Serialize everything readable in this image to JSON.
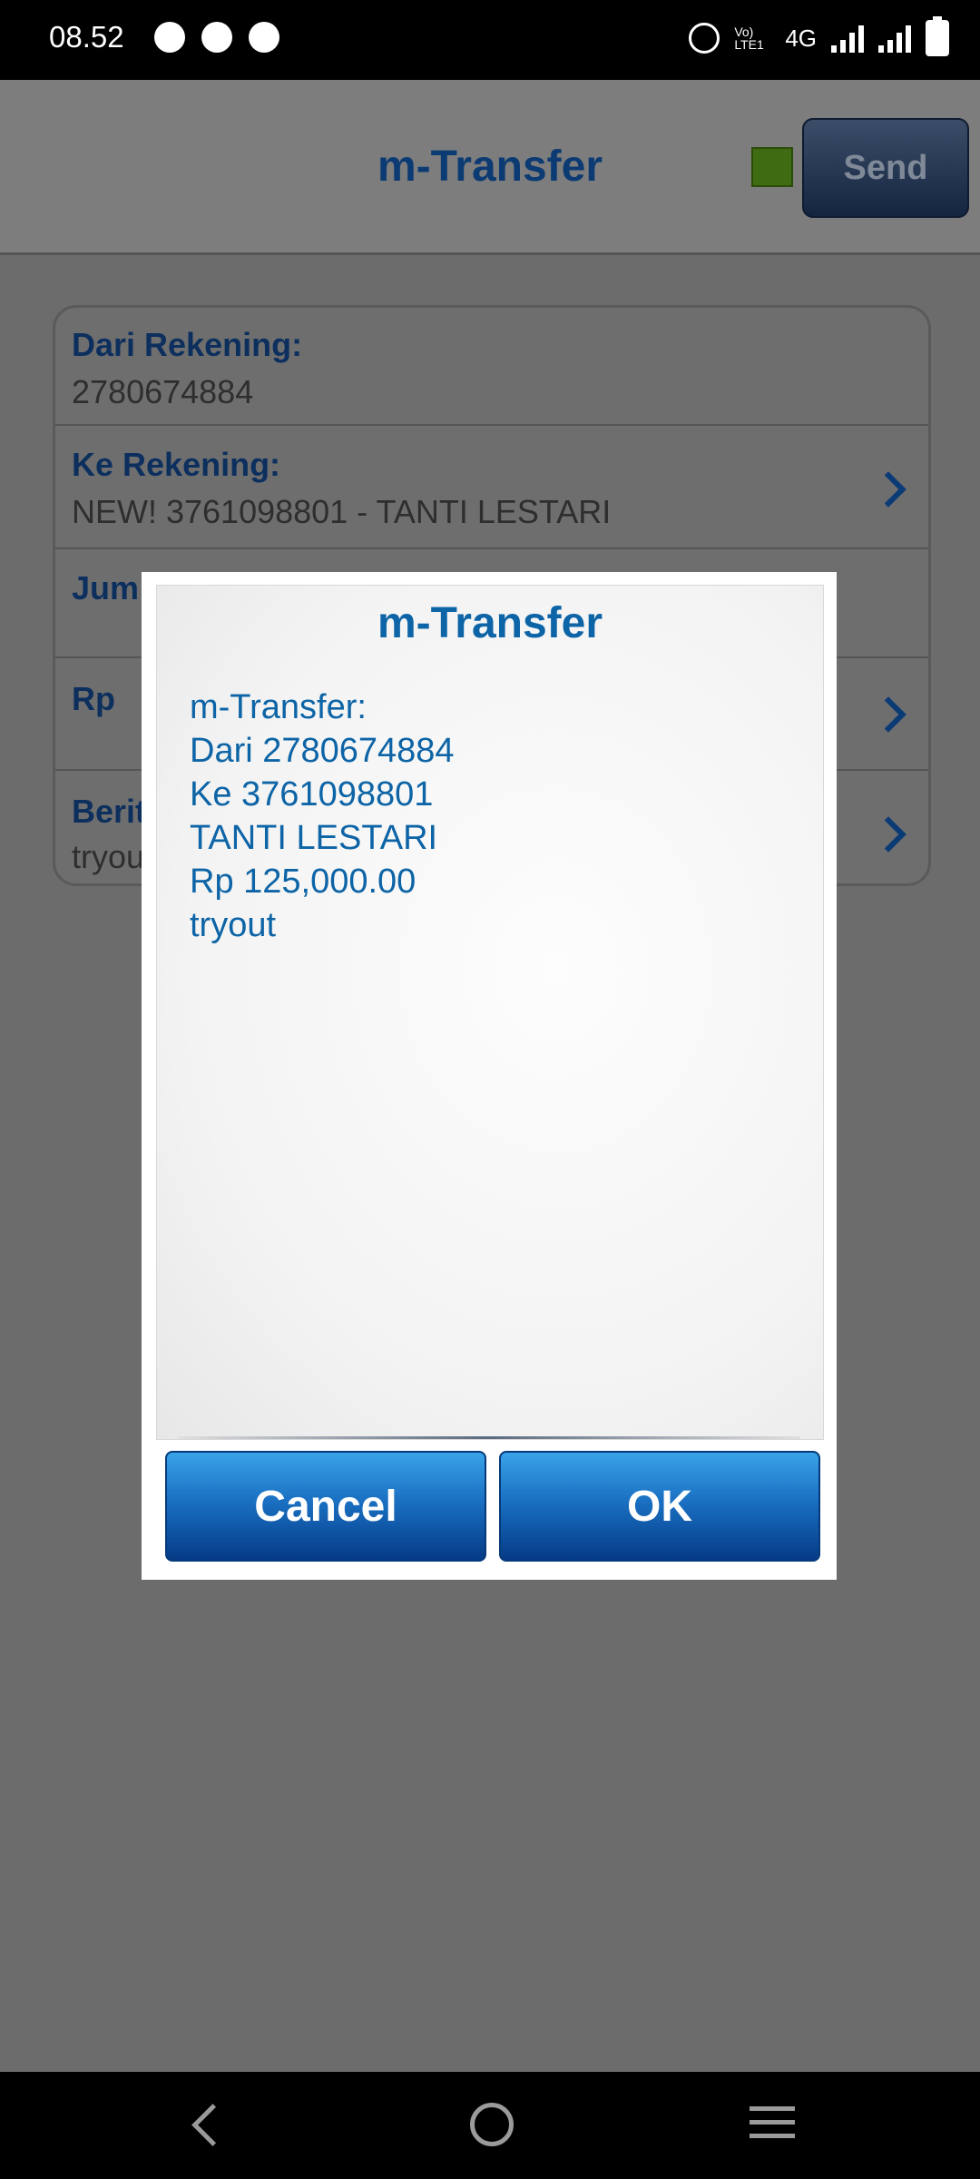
{
  "status_bar": {
    "time": "08.52",
    "network": "4G",
    "volte": "Vo) LTE1"
  },
  "header": {
    "title": "m-Transfer",
    "send_label": "Send",
    "status_color": "#3f6b12"
  },
  "form": {
    "rows": [
      {
        "label": "Dari Rekening:",
        "value": "2780674884"
      },
      {
        "label": "Ke Rekening:",
        "value": "NEW! 3761098801 - TANTI LESTARI"
      },
      {
        "label": "Jum",
        "value": ""
      },
      {
        "label": "Rp",
        "value": ""
      },
      {
        "label": "Berit",
        "value": "tryou"
      }
    ]
  },
  "dialog": {
    "title": "m-Transfer",
    "lines": [
      "m-Transfer:",
      "Dari 2780674884",
      "Ke 3761098801",
      "TANTI LESTARI",
      "Rp 125,000.00",
      "tryout"
    ],
    "cancel_label": "Cancel",
    "ok_label": "OK"
  },
  "nav": {
    "back_icon": "back-icon",
    "home_icon": "home-icon",
    "menu_icon": "menu-icon"
  },
  "colors": {
    "accent": "#0d64a6",
    "header_text": "#0c3a73"
  }
}
